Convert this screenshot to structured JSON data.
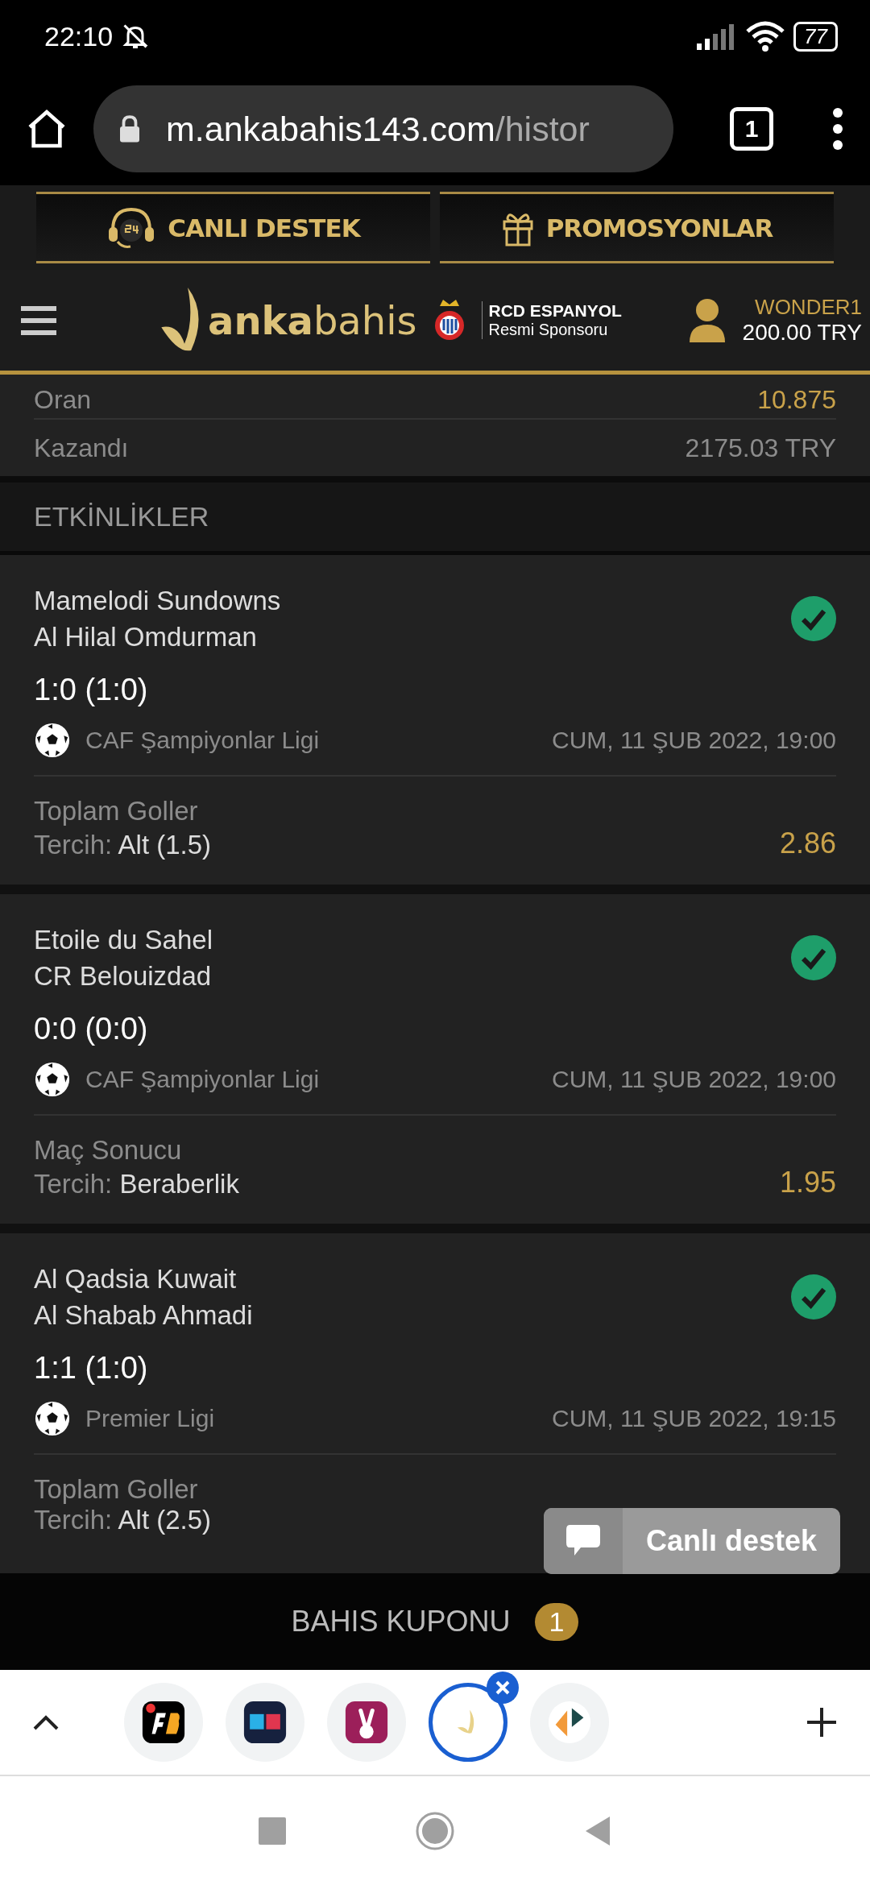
{
  "status_bar": {
    "time": "22:10",
    "battery": "77"
  },
  "browser": {
    "url_host": "m.ankabahis143.com",
    "url_path": "/histor",
    "tab_count": "1"
  },
  "promo_buttons": [
    {
      "label": "CANLI DESTEK",
      "kind": "support"
    },
    {
      "label": "PROMOSYONLAR",
      "kind": "gift"
    }
  ],
  "header": {
    "logo": "**anka**bahis",
    "sponsor_name": "RCD ESPANYOL",
    "sponsor_note": "Resmi Sponsoru",
    "username": "WONDER1",
    "balance": "200.00 TRY"
  },
  "summary": [
    {
      "label": "Oran",
      "value": "10.875",
      "kind": "odds"
    },
    {
      "label": "Kazandı",
      "value": "2175.03 TRY",
      "kind": "amount"
    }
  ],
  "section_title": "ETKİNLİKLER",
  "events": [
    {
      "teams": [
        "Mamelodi Sundowns",
        "Al Hilal Omdurman"
      ],
      "score": "1:0 (1:0)",
      "league": "CAF Şampiyonlar Ligi",
      "datetime": "CUM, 11 ŞUB 2022, 19:00",
      "market": "Toplam Goller",
      "pick_label": "Tercih:",
      "pick": "Alt (1.5)",
      "odds": "2.86",
      "won": true
    },
    {
      "teams": [
        "Etoile du Sahel",
        "CR Belouizdad"
      ],
      "score": "0:0 (0:0)",
      "league": "CAF Şampiyonlar Ligi",
      "datetime": "CUM, 11 ŞUB 2022, 19:00",
      "market": "Maç Sonucu",
      "pick_label": "Tercih:",
      "pick": "Beraberlik",
      "odds": "1.95",
      "won": true
    },
    {
      "teams": [
        "Al Qadsia Kuwait",
        "Al Shabab Ahmadi"
      ],
      "score": "1:1 (1:0)",
      "league": "Premier Ligi",
      "datetime": "CUM, 11 ŞUB 2022, 19:15",
      "market": "Toplam Goller",
      "pick_label": "Tercih:",
      "pick": "Alt (2.5)",
      "won": true
    }
  ],
  "chat_button": {
    "label": "Canlı destek"
  },
  "bet_slip": {
    "label": "BAHIS KUPONU",
    "count": "1"
  },
  "tab_strip": [
    {
      "kind": "fb",
      "selected": false
    },
    {
      "kind": "sb",
      "selected": false
    },
    {
      "kind": "peace",
      "selected": false
    },
    {
      "kind": "anka",
      "selected": true
    },
    {
      "kind": "split",
      "selected": false
    }
  ]
}
